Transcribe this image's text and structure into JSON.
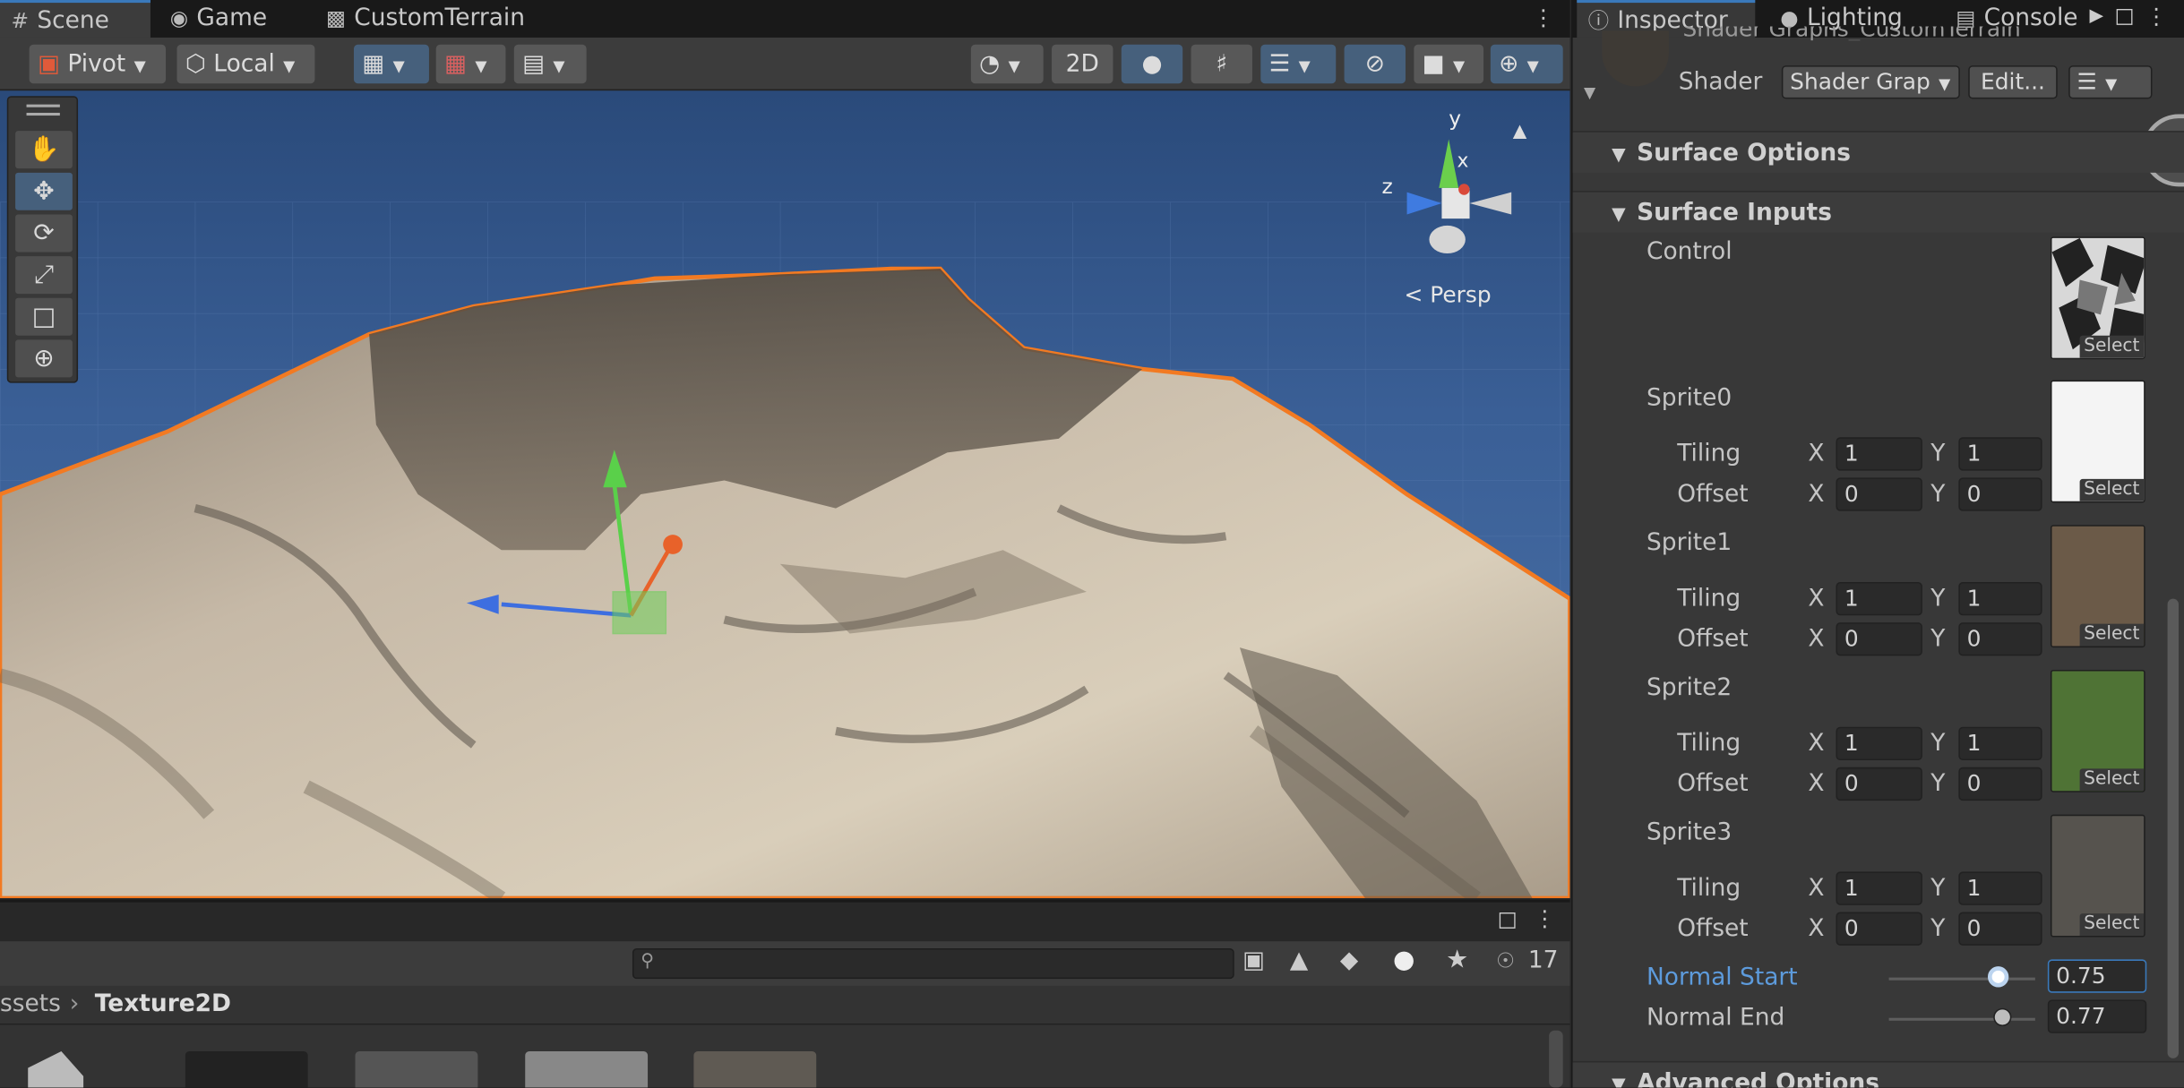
{
  "scene_tabs": [
    {
      "label": "Scene",
      "icon": "hash-icon"
    },
    {
      "label": "Game",
      "icon": "gamepad-icon"
    },
    {
      "label": "CustomTerrain",
      "icon": "prefab-icon"
    }
  ],
  "toolbar": {
    "pivot_label": "Pivot",
    "local_label": "Local",
    "mode_2d_label": "2D"
  },
  "viewport": {
    "persp_label": "Persp",
    "gizmo_axes": {
      "y": "y",
      "z": "z",
      "x": "x"
    }
  },
  "project": {
    "search_placeholder": "",
    "hidden_count": "17",
    "breadcrumb_root": "ssets",
    "breadcrumb_current": "Texture2D"
  },
  "inspector_tabs": [
    {
      "label": "Inspector",
      "icon": "info-icon"
    },
    {
      "label": "Lighting",
      "icon": "bulb-icon"
    },
    {
      "label": "Console",
      "icon": "console-icon"
    }
  ],
  "material": {
    "shader_label": "Shader",
    "shader_value": "Shader Grap",
    "edit_label": "Edit...",
    "name_partial": "Shader Graphs_CustomTerrain"
  },
  "sections": {
    "surface_options": "Surface Options",
    "surface_inputs": "Surface Inputs",
    "advanced_options": "Advanced Options"
  },
  "control_label": "Control",
  "select_label": "Select",
  "tiling_label": "Tiling",
  "offset_label": "Offset",
  "x_label": "X",
  "y_label": "Y",
  "sprites": [
    {
      "name": "Sprite0",
      "tiling_x": "1",
      "tiling_y": "1",
      "offset_x": "0",
      "offset_y": "0",
      "texture_color": "#f4f4f4"
    },
    {
      "name": "Sprite1",
      "tiling_x": "1",
      "tiling_y": "1",
      "offset_x": "0",
      "offset_y": "0",
      "texture_color": "#6b5a48"
    },
    {
      "name": "Sprite2",
      "tiling_x": "1",
      "tiling_y": "1",
      "offset_x": "0",
      "offset_y": "0",
      "texture_color": "#4f7335"
    },
    {
      "name": "Sprite3",
      "tiling_x": "1",
      "tiling_y": "1",
      "offset_x": "0",
      "offset_y": "0",
      "texture_color": "#56534e"
    }
  ],
  "normal_start": {
    "label": "Normal Start",
    "value": "0.75",
    "slider_fraction": 0.75
  },
  "normal_end": {
    "label": "Normal End",
    "value": "0.77",
    "slider_fraction": 0.77
  },
  "colors": {
    "accent": "#3a79bb",
    "selection_outline": "#f27a22"
  }
}
